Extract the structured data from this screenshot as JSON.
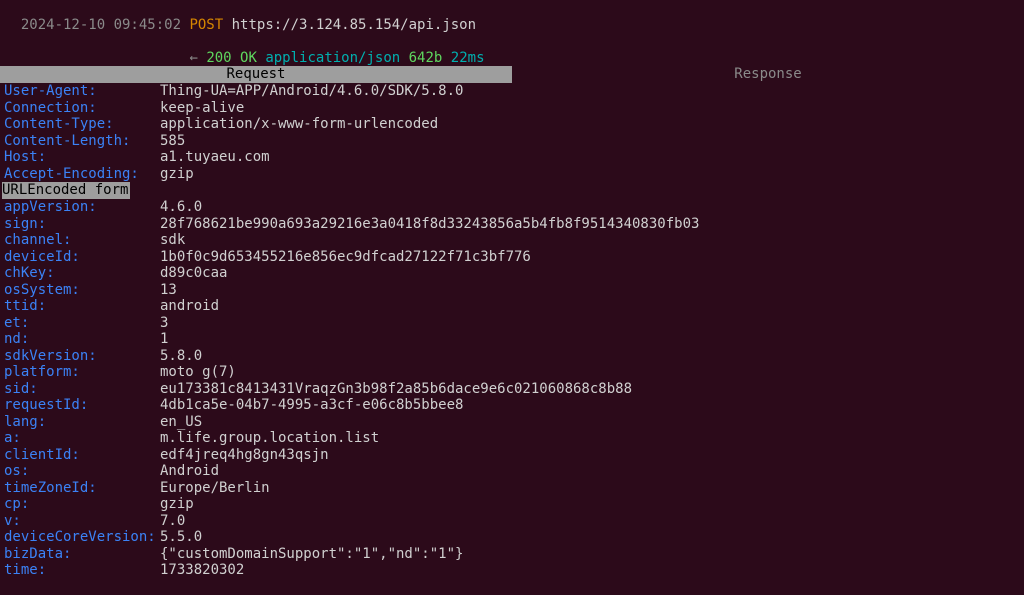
{
  "topline": {
    "timestamp": "2024-12-10 09:45:02",
    "method": "POST",
    "url": "https://3.124.85.154/api.json",
    "arrow": "←",
    "status": "200 OK",
    "content_type": "application/json",
    "size": "642b",
    "latency": "22ms"
  },
  "tabs": {
    "request": "Request",
    "response": "Response"
  },
  "sections": {
    "urlencoded": "URLEncoded form"
  },
  "headers": [
    {
      "k": "User-Agent",
      "v": "Thing-UA=APP/Android/4.6.0/SDK/5.8.0"
    },
    {
      "k": "Connection",
      "v": "keep-alive"
    },
    {
      "k": "Content-Type",
      "v": "application/x-www-form-urlencoded"
    },
    {
      "k": "Content-Length",
      "v": "585"
    },
    {
      "k": "Host",
      "v": "a1.tuyaeu.com"
    },
    {
      "k": "Accept-Encoding",
      "v": "gzip"
    }
  ],
  "form": [
    {
      "k": "appVersion",
      "v": "4.6.0"
    },
    {
      "k": "sign",
      "v": "28f768621be990a693a29216e3a0418f8d33243856a5b4fb8f9514340830fb03"
    },
    {
      "k": "channel",
      "v": "sdk"
    },
    {
      "k": "deviceId",
      "v": "1b0f0c9d653455216e856ec9dfcad27122f71c3bf776"
    },
    {
      "k": "chKey",
      "v": "d89c0caa"
    },
    {
      "k": "osSystem",
      "v": "13"
    },
    {
      "k": "ttid",
      "v": "android"
    },
    {
      "k": "et",
      "v": "3"
    },
    {
      "k": "nd",
      "v": "1"
    },
    {
      "k": "sdkVersion",
      "v": "5.8.0"
    },
    {
      "k": "platform",
      "v": "moto g(7)"
    },
    {
      "k": "sid",
      "v": "eu173381c8413431VraqzGn3b98f2a85b6dace9e6c021060868c8b88"
    },
    {
      "k": "requestId",
      "v": "4db1ca5e-04b7-4995-a3cf-e06c8b5bbee8"
    },
    {
      "k": "lang",
      "v": "en_US"
    },
    {
      "k": "a",
      "v": "m.life.group.location.list"
    },
    {
      "k": "clientId",
      "v": "edf4jreq4hg8gn43qsjn"
    },
    {
      "k": "os",
      "v": "Android"
    },
    {
      "k": "timeZoneId",
      "v": "Europe/Berlin"
    },
    {
      "k": "cp",
      "v": "gzip"
    },
    {
      "k": "v",
      "v": "7.0"
    },
    {
      "k": "deviceCoreVersion",
      "v": "5.5.0"
    },
    {
      "k": "bizData",
      "v": "{\"customDomainSupport\":\"1\",\"nd\":\"1\"}"
    },
    {
      "k": "time",
      "v": "1733820302"
    }
  ]
}
